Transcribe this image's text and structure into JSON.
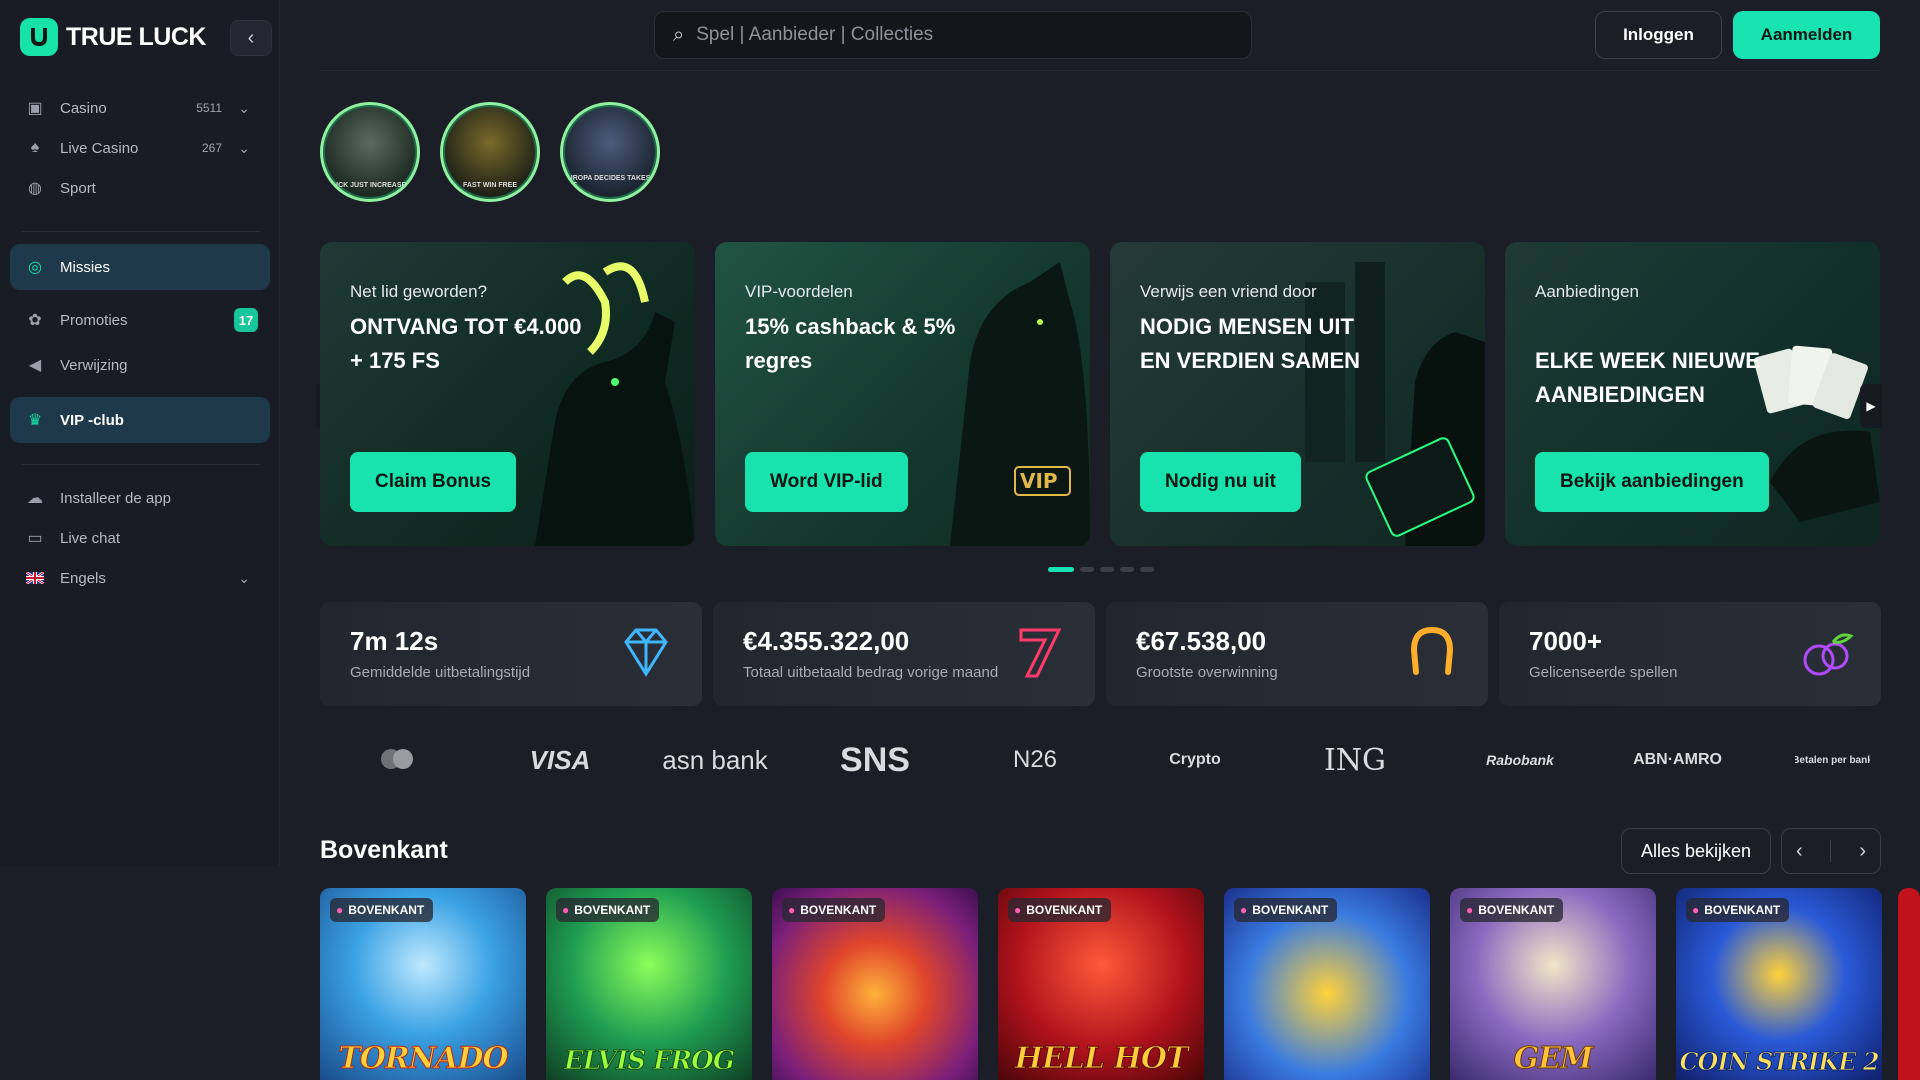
{
  "sidebar": {
    "logo_text": "TRUE LUCK",
    "collapse_icon": "chevron-left-icon",
    "items": [
      {
        "label": "Casino",
        "count": "5511",
        "icon": "slot-machine-icon"
      },
      {
        "label": "Live Casino",
        "count": "267",
        "icon": "spade-icon"
      },
      {
        "label": "Sport",
        "icon": "ball-icon"
      },
      {
        "label": "Missies",
        "icon": "target-icon"
      },
      {
        "label": "Promoties",
        "badge": "17",
        "icon": "gift-icon"
      },
      {
        "label": "Verwijzing",
        "icon": "megaphone-icon"
      },
      {
        "label": "VIP -club",
        "icon": "crown-icon"
      },
      {
        "label": "Installeer de app",
        "icon": "cloud-download-icon"
      },
      {
        "label": "Live chat",
        "icon": "chat-icon"
      },
      {
        "label": "Engels",
        "icon": "uk-flag-icon"
      }
    ]
  },
  "header": {
    "search_placeholder": "Spel | Aanbieder | Collecties",
    "login_label": "Inloggen",
    "signup_label": "Aanmelden"
  },
  "stories": [
    {
      "caption": "LUCK JUST INCREASED"
    },
    {
      "caption": "FAST WIN FREE"
    },
    {
      "caption": "EUROPA DECIDES TAKES THE"
    }
  ],
  "promos": [
    {
      "kicker": "Net lid geworden?",
      "headline": "ONTVANG TOT €4.000 + 175 FS",
      "cta": "Claim Bonus"
    },
    {
      "kicker": "VIP-voordelen",
      "headline": "15% cashback & 5% regres",
      "cta": "Word VIP-lid"
    },
    {
      "kicker": "Verwijs een vriend door",
      "headline": "NODIG MENSEN UIT EN VERDIEN SAMEN",
      "cta": "Nodig nu uit"
    },
    {
      "kicker": "Aanbiedingen",
      "headline": "ELKE WEEK NIEUWE AANBIEDINGEN",
      "cta": "Bekijk aanbiedingen"
    }
  ],
  "stats": [
    {
      "value": "7m 12s",
      "label": "Gemiddelde uitbetalingstijd",
      "icon": "diamond-icon",
      "color": "#3fb7ff"
    },
    {
      "value": "€4.355.322,00",
      "label": "Totaal uitbetaald bedrag vorige maand",
      "icon": "seven-icon",
      "color": "#ff3b6b"
    },
    {
      "value": "€67.538,00",
      "label": "Grootste overwinning",
      "icon": "horseshoe-icon",
      "color": "#ffae2b"
    },
    {
      "value": "7000+",
      "label": "Gelicenseerde spellen",
      "icon": "plum-icon",
      "color": "#b04bff"
    }
  ],
  "payments": [
    "mastercard",
    "VISA",
    "asn bank",
    "SNS",
    "N26",
    "Crypto",
    "ING",
    "Rabobank",
    "ABN·AMRO",
    "Betalen per bank"
  ],
  "section": {
    "title": "Bovenkant",
    "view_all": "Alles bekijken"
  },
  "games": [
    {
      "tag": "BOVENKANT",
      "title": "TORNADO"
    },
    {
      "tag": "BOVENKANT",
      "title": "ELVIS FROG"
    },
    {
      "tag": "BOVENKANT",
      "title": ""
    },
    {
      "tag": "BOVENKANT",
      "title": "HELL HOT"
    },
    {
      "tag": "BOVENKANT",
      "title": ""
    },
    {
      "tag": "BOVENKANT",
      "title": "GEM"
    },
    {
      "tag": "BOVENKANT",
      "title": "COIN STRIKE 2"
    }
  ],
  "colors": {
    "accent": "#19e3b0",
    "badge": "#17c69a"
  }
}
